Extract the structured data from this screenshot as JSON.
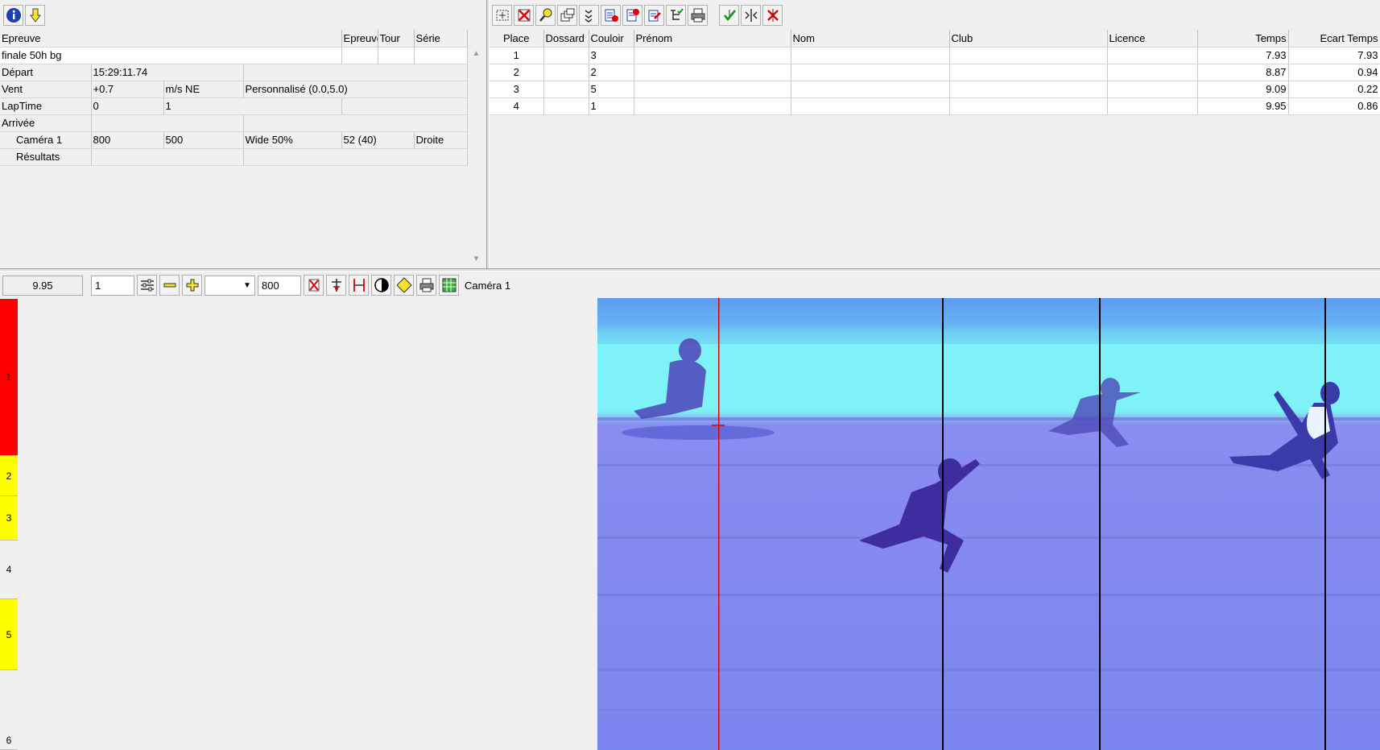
{
  "left_toolbar": {
    "buttons": [
      "info-icon",
      "download-arrow-icon"
    ]
  },
  "event_table": {
    "headers": [
      "Epreuve",
      "Epreuve n",
      "Tour",
      "Série"
    ],
    "event_name": "finale 50h bg",
    "rows": {
      "depart": {
        "label": "Départ",
        "time": "15:29:11.74"
      },
      "vent": {
        "label": "Vent",
        "value": "+0.7",
        "unit": "m/s NE",
        "mode": "Personnalisé (0.0,5.0)"
      },
      "laptime": {
        "label": "LapTime",
        "v1": "0",
        "v2": "1"
      },
      "arrivee": {
        "label": "Arrivée"
      },
      "camera": {
        "label": "Caméra 1",
        "v1": "800",
        "v2": "500",
        "v3": "Wide 50%",
        "v4": "52  (40)",
        "v5": "Droite"
      },
      "resultats": {
        "label": "Résultats"
      }
    }
  },
  "right_toolbar": {
    "buttons": [
      "select-all-icon",
      "delete-red-x-icon",
      "magnifier-icon",
      "windows-icon",
      "check-list-icon",
      "export-1-icon",
      "export-2-icon",
      "export-3-icon",
      "tree-list-icon",
      "printer-icon",
      "green-check-icon",
      "split-icon",
      "red-cross-icon"
    ]
  },
  "results_table": {
    "headers": [
      "Place",
      "Dossard",
      "Couloir",
      "Prénom",
      "Nom",
      "Club",
      "Licence",
      "Temps",
      "Ecart Temps"
    ],
    "rows": [
      {
        "place": "1",
        "dossard": "",
        "couloir": "3",
        "prenom": "",
        "nom": "",
        "club": "",
        "licence": "",
        "temps": "7.93",
        "ecart": "7.93"
      },
      {
        "place": "2",
        "dossard": "",
        "couloir": "2",
        "prenom": "",
        "nom": "",
        "club": "",
        "licence": "",
        "temps": "8.87",
        "ecart": "0.94"
      },
      {
        "place": "3",
        "dossard": "",
        "couloir": "5",
        "prenom": "",
        "nom": "",
        "club": "",
        "licence": "",
        "temps": "9.09",
        "ecart": "0.22"
      },
      {
        "place": "4",
        "dossard": "",
        "couloir": "1",
        "prenom": "",
        "nom": "",
        "club": "",
        "licence": "",
        "temps": "9.95",
        "ecart": "0.86"
      }
    ]
  },
  "viewer_toolbar": {
    "time": "9.95",
    "step": "1",
    "zoom_value": "",
    "width_value": "800",
    "camera_label": "Caméra 1",
    "buttons": [
      "settings-lines-icon",
      "minus-icon",
      "plus-icon",
      "red-x-icon",
      "align-icon",
      "measure-icon",
      "contrast-icon",
      "diamond-icon",
      "print-icon",
      "grid-icon"
    ]
  },
  "lanes": [
    {
      "label": "1",
      "color": "#ff0000"
    },
    {
      "label": "2",
      "color": "#ffff00"
    },
    {
      "label": "3",
      "color": "#ffff00"
    },
    {
      "label": "4",
      "color": "#f0f0f0"
    },
    {
      "label": "5",
      "color": "#ffff00"
    },
    {
      "label": "6",
      "color": "#f0f0f0"
    }
  ],
  "colors": {
    "accent_red": "#e00000",
    "photo_base": "#7c8cf0",
    "photo_band": "#7ef2f6"
  }
}
